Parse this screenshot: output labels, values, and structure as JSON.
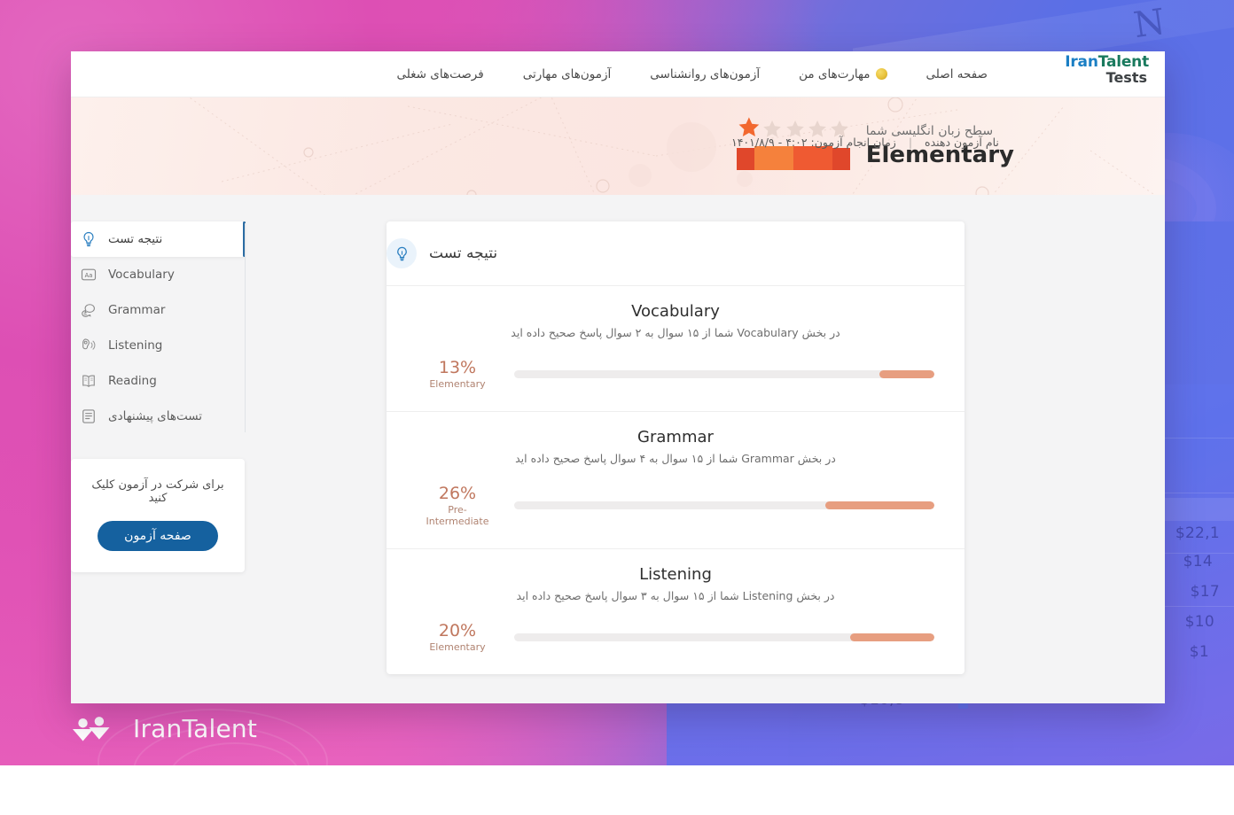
{
  "nav": {
    "brand_line1_a": "Iran",
    "brand_line1_b": "Talent",
    "brand_line2": "Tests",
    "links": [
      {
        "label": "صفحه اصلی",
        "icon": ""
      },
      {
        "label": "مهارت‌های من",
        "icon": "coin-icon"
      },
      {
        "label": "آزمون‌های روانشناسی",
        "icon": ""
      },
      {
        "label": "آزمون‌های مهارتی",
        "icon": ""
      },
      {
        "label": "فرصت‌های شغلی",
        "icon": ""
      }
    ]
  },
  "hero": {
    "subtitle": "سطح زبان انگلیسی شما",
    "level": "Elementary",
    "stars_total": 5,
    "stars_filled": 1,
    "taker_name": "نام آزمون دهنده",
    "separator": "|",
    "exam_time_label": "زمان انجام آزمون:",
    "exam_time_value": "۴:۰۲ - ۱۴۰۱/۸/۹"
  },
  "sidebar": {
    "items": [
      {
        "label": "نتیجه تست",
        "icon": "lightbulb-icon",
        "active": true,
        "lang": "fa"
      },
      {
        "label": "Vocabulary",
        "icon": "letters-aa-icon",
        "active": false,
        "lang": "en"
      },
      {
        "label": "Grammar",
        "icon": "speech-bubbles-icon",
        "active": false,
        "lang": "en"
      },
      {
        "label": "Listening",
        "icon": "ear-headphone-icon",
        "active": false,
        "lang": "en"
      },
      {
        "label": "Reading",
        "icon": "open-book-icon",
        "active": false,
        "lang": "en"
      },
      {
        "label": "تست‌های پیشنهادی",
        "icon": "document-list-icon",
        "active": false,
        "lang": "fa"
      }
    ],
    "cta": {
      "text": "برای شرکت در آزمون کلیک کنید",
      "button_label": "صفحه آزمون"
    }
  },
  "card": {
    "title": "نتیجه تست",
    "icon": "lightbulb-icon",
    "skills": [
      {
        "name": "Vocabulary",
        "description": "در بخش Vocabulary شما از ۱۵ سوال به ۲ سوال پاسخ صحیح داده اید",
        "percent_label": "13%",
        "percent": 13,
        "level": "Elementary"
      },
      {
        "name": "Grammar",
        "description": "در بخش Grammar شما از ۱۵ سوال به ۴ سوال پاسخ صحیح داده اید",
        "percent_label": "26%",
        "percent": 26,
        "level": "Pre-Intermediate"
      },
      {
        "name": "Listening",
        "description": "در بخش Listening شما از ۱۵ سوال به ۳ سوال پاسخ صحیح داده اید",
        "percent_label": "20%",
        "percent": 20,
        "level": "Elementary"
      }
    ]
  },
  "footer": {
    "logo_text": "IranTalent",
    "logo_icon": "two-people-icon"
  },
  "colors": {
    "brand_blue": "#1b7fc4",
    "brand_green": "#1a7a5e",
    "cta_button": "#15619f",
    "progress_fill": "#e79e80",
    "progress_track": "#eeecec",
    "score_text": "#c0775e",
    "banner_bg": "#fbe8e3",
    "page_bg": "#f4f4f5",
    "backdrop_pink": "#e152b6",
    "backdrop_blue": "#5f72ea"
  }
}
